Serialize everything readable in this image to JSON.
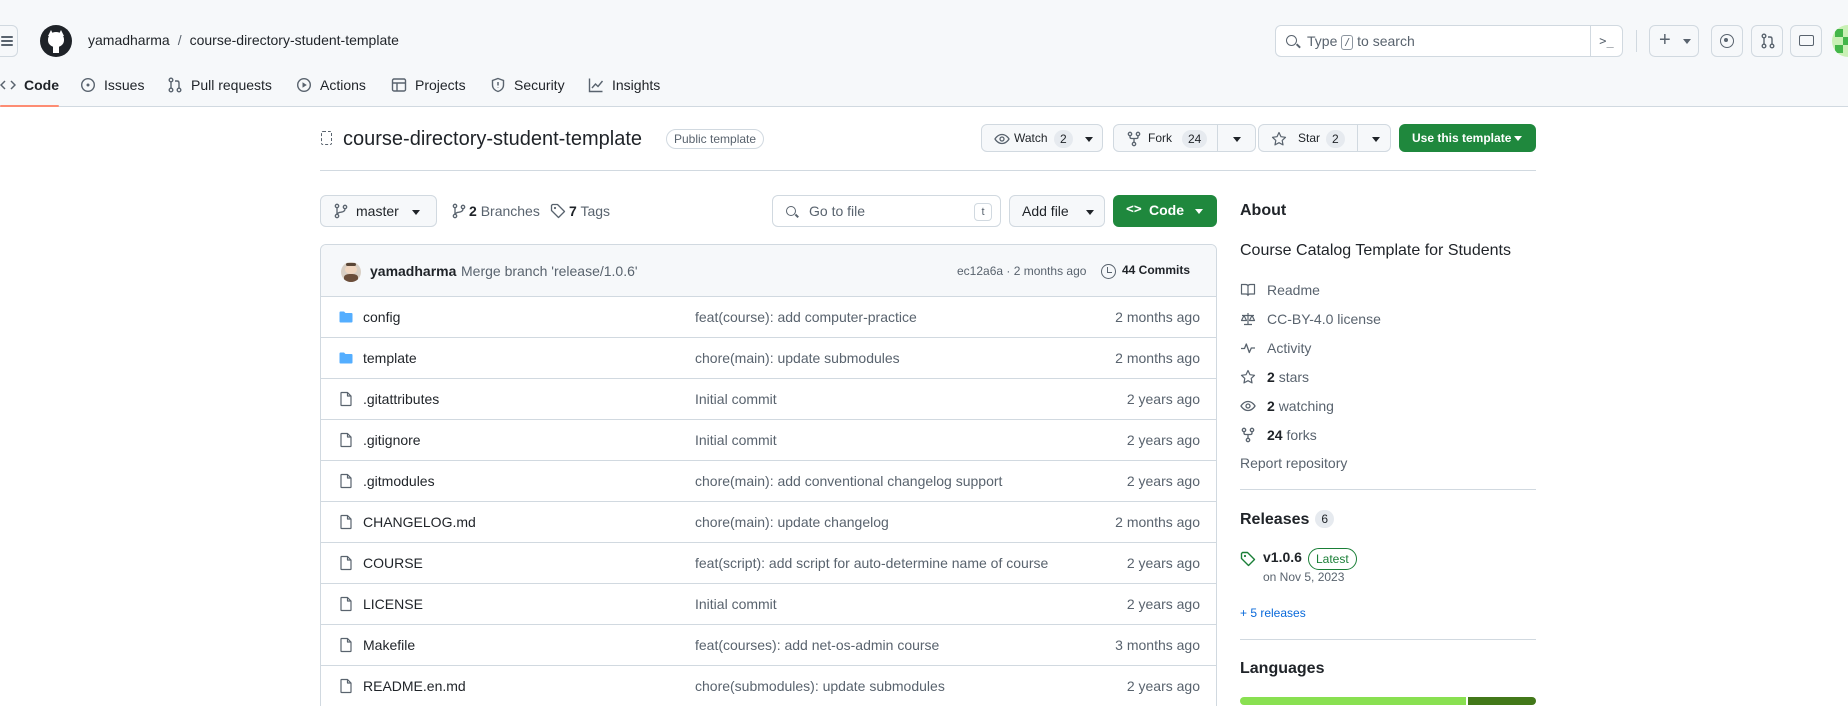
{
  "header": {
    "owner": "yamadharma",
    "separator": "/",
    "repo": "course-directory-student-template",
    "search_prefix": "Type",
    "search_key": "/",
    "search_suffix": "to search",
    "command_glyph": ">_",
    "plus_glyph": "+"
  },
  "tabs": [
    {
      "label": "Code",
      "icon": "code-icon"
    },
    {
      "label": "Issues",
      "icon": "issue-opened-icon"
    },
    {
      "label": "Pull requests",
      "icon": "git-pull-request-icon"
    },
    {
      "label": "Actions",
      "icon": "play-icon"
    },
    {
      "label": "Projects",
      "icon": "table-icon"
    },
    {
      "label": "Security",
      "icon": "shield-icon"
    },
    {
      "label": "Insights",
      "icon": "graph-icon"
    }
  ],
  "repo": {
    "name": "course-directory-student-template",
    "visibility": "Public template",
    "watch_label": "Watch",
    "watch_count": "2",
    "fork_label": "Fork",
    "fork_count": "24",
    "star_label": "Star",
    "star_count": "2",
    "use_template_label": "Use this template"
  },
  "toolbar": {
    "branch": "master",
    "branches_count": "2",
    "branches_label": "Branches",
    "tags_count": "7",
    "tags_label": "Tags",
    "goto_placeholder": "Go to file",
    "goto_shortcut": "t",
    "add_file_label": "Add file",
    "code_label": "Code",
    "code_glyph": "<>"
  },
  "latest_commit": {
    "author": "yamadharma",
    "message": "Merge branch 'release/1.0.6'",
    "sha_time": "ec12a6a · 2 months ago",
    "commits_count": "44 Commits"
  },
  "files": [
    {
      "name": "config",
      "type": "folder",
      "message": "feat(course): add computer-practice",
      "date": "2 months ago"
    },
    {
      "name": "template",
      "type": "folder",
      "message": "chore(main): update submodules",
      "date": "2 months ago"
    },
    {
      "name": ".gitattributes",
      "type": "file",
      "message": "Initial commit",
      "date": "2 years ago"
    },
    {
      "name": ".gitignore",
      "type": "file",
      "message": "Initial commit",
      "date": "2 years ago"
    },
    {
      "name": ".gitmodules",
      "type": "file",
      "message": "chore(main): add conventional changelog support",
      "date": "2 years ago"
    },
    {
      "name": "CHANGELOG.md",
      "type": "file",
      "message": "chore(main): update changelog",
      "date": "2 months ago"
    },
    {
      "name": "COURSE",
      "type": "file",
      "message": "feat(script): add script for auto-determine name of course",
      "date": "2 years ago"
    },
    {
      "name": "LICENSE",
      "type": "file",
      "message": "Initial commit",
      "date": "2 years ago"
    },
    {
      "name": "Makefile",
      "type": "file",
      "message": "feat(courses): add net-os-admin course",
      "date": "3 months ago"
    },
    {
      "name": "README.en.md",
      "type": "file",
      "message": "chore(submodules): update submodules",
      "date": "2 years ago"
    }
  ],
  "about": {
    "heading": "About",
    "description": "Course Catalog Template for Students",
    "items": [
      {
        "icon": "book-icon",
        "label": "Readme"
      },
      {
        "icon": "law-icon",
        "label": "CC-BY-4.0 license"
      },
      {
        "icon": "pulse-icon",
        "label": "Activity"
      },
      {
        "icon": "star-icon",
        "count": "2",
        "label": "stars"
      },
      {
        "icon": "eye-icon",
        "count": "2",
        "label": "watching"
      },
      {
        "icon": "repo-forked-icon",
        "count": "24",
        "label": "forks"
      }
    ],
    "report": "Report repository"
  },
  "releases": {
    "heading": "Releases",
    "count": "6",
    "version": "v1.0.6",
    "latest_label": "Latest",
    "date": "on Nov 5, 2023",
    "more": "+ 5 releases"
  },
  "languages": {
    "heading": "Languages",
    "bar": [
      {
        "color": "#89e051",
        "fraction": 0.765
      },
      {
        "color": "#427819",
        "fraction": 0.23
      }
    ]
  },
  "colors": {
    "accent_green": "#1f883d",
    "tab_underline": "#fd8c73",
    "folder_blue": "#54aeff",
    "link_blue": "#0969da"
  }
}
